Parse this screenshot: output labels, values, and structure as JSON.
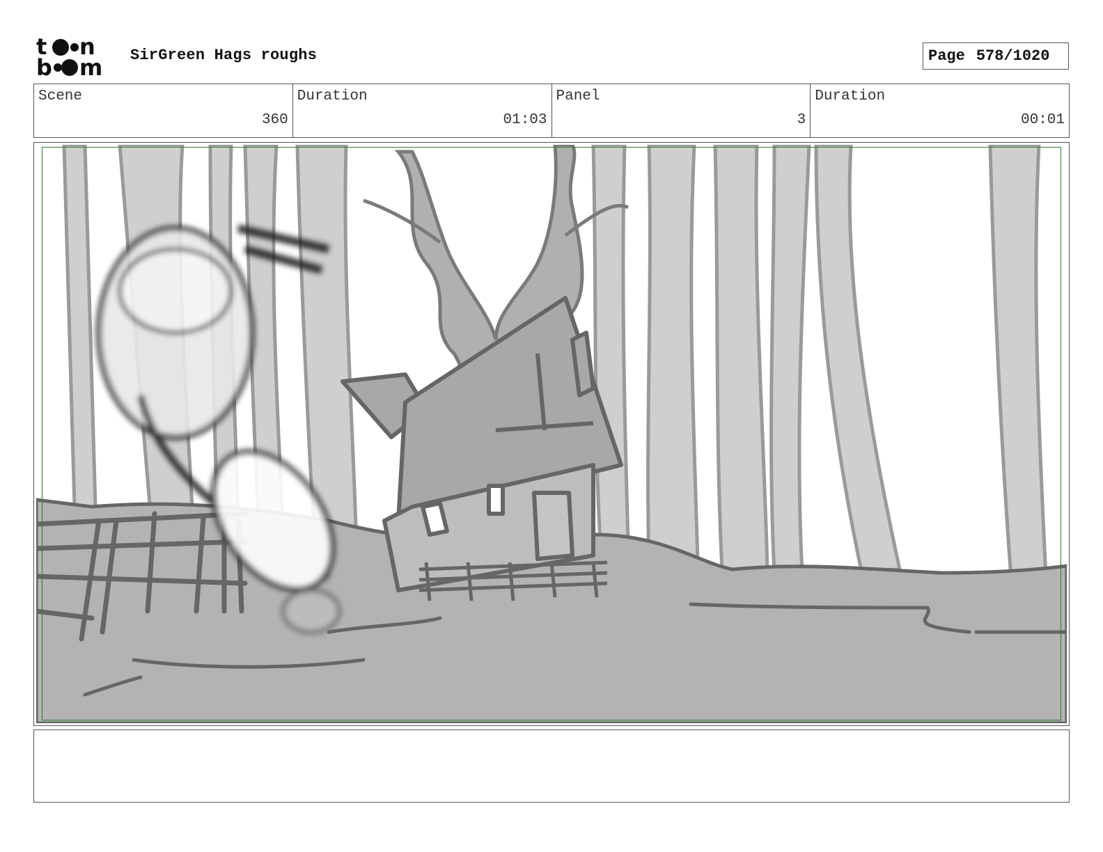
{
  "header": {
    "logo_text": "toon boom",
    "title": "SirGreen Hags roughs",
    "page_label": "Page",
    "page_number": "578/1020"
  },
  "info": {
    "scene_label": "Scene",
    "scene_value": "360",
    "scene_duration_label": "Duration",
    "scene_duration_value": "01:03",
    "panel_label": "Panel",
    "panel_value": "3",
    "panel_duration_label": "Duration",
    "panel_duration_value": "00:01"
  },
  "panel": {
    "frame_color": "#2e7d32"
  },
  "notes": {
    "text": ""
  }
}
